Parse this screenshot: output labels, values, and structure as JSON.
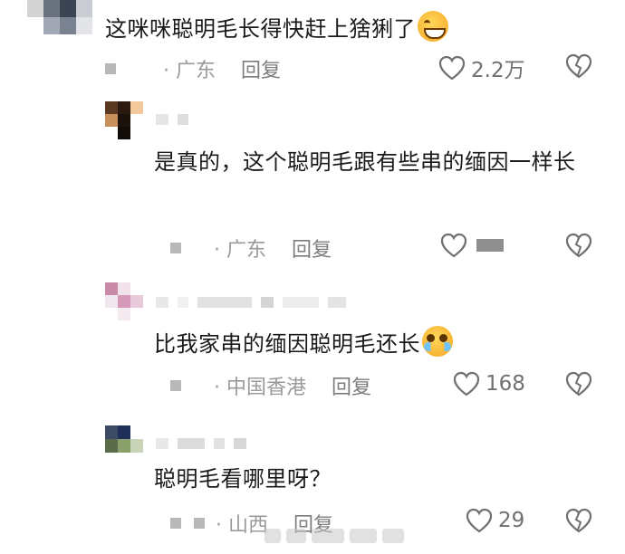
{
  "comments": [
    {
      "text": "这咪咪聪明毛长得快赶上猞猁了",
      "emoji": "grinning-sweat-emoji",
      "location": "· 广东",
      "reply_label": "回复",
      "likes": "2.2万"
    },
    {
      "text": "是真的，这个聪明毛跟有些串的缅因一样长",
      "location": "· 广东",
      "reply_label": "回复",
      "likes": ""
    },
    {
      "text": "比我家串的缅因聪明毛还长",
      "emoji": "crying-emoji",
      "location": "· 中国香港",
      "reply_label": "回复",
      "likes": "168"
    },
    {
      "text": "聪明毛看哪里呀？",
      "location": "· 山西",
      "reply_label": "回复",
      "likes": "29"
    }
  ],
  "colors": {
    "text": "#1a1a1a",
    "meta": "#9a9a9a",
    "icon": "#707070",
    "mask": "#d9d9d9"
  }
}
